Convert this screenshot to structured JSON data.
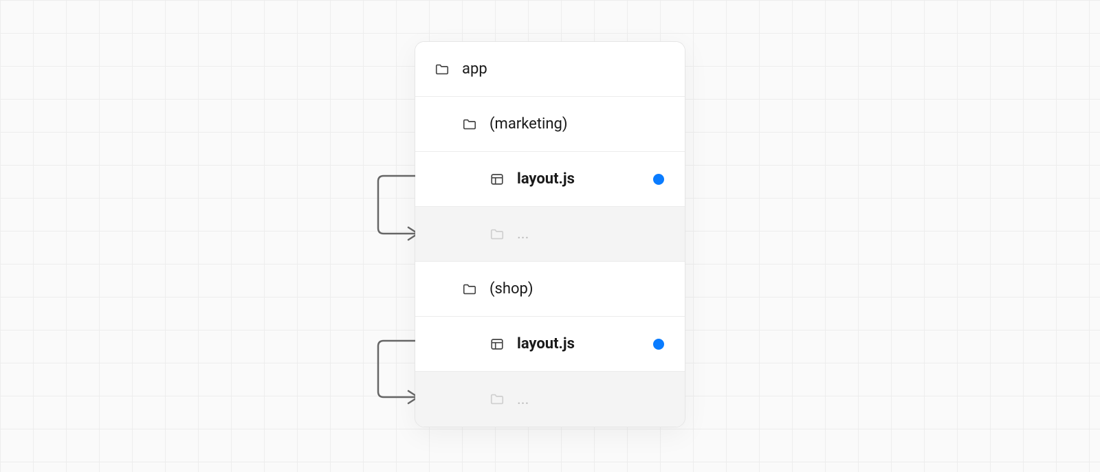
{
  "tree": {
    "root": {
      "label": "app",
      "icon": "folder"
    },
    "groups": [
      {
        "folder": {
          "label": "(marketing)",
          "icon": "folder"
        },
        "file": {
          "label": "layout.js",
          "icon": "layout",
          "dot": true
        },
        "more": {
          "label": "...",
          "icon": "folder"
        }
      },
      {
        "folder": {
          "label": "(shop)",
          "icon": "folder"
        },
        "file": {
          "label": "layout.js",
          "icon": "layout",
          "dot": true
        },
        "more": {
          "label": "...",
          "icon": "folder"
        }
      }
    ]
  }
}
